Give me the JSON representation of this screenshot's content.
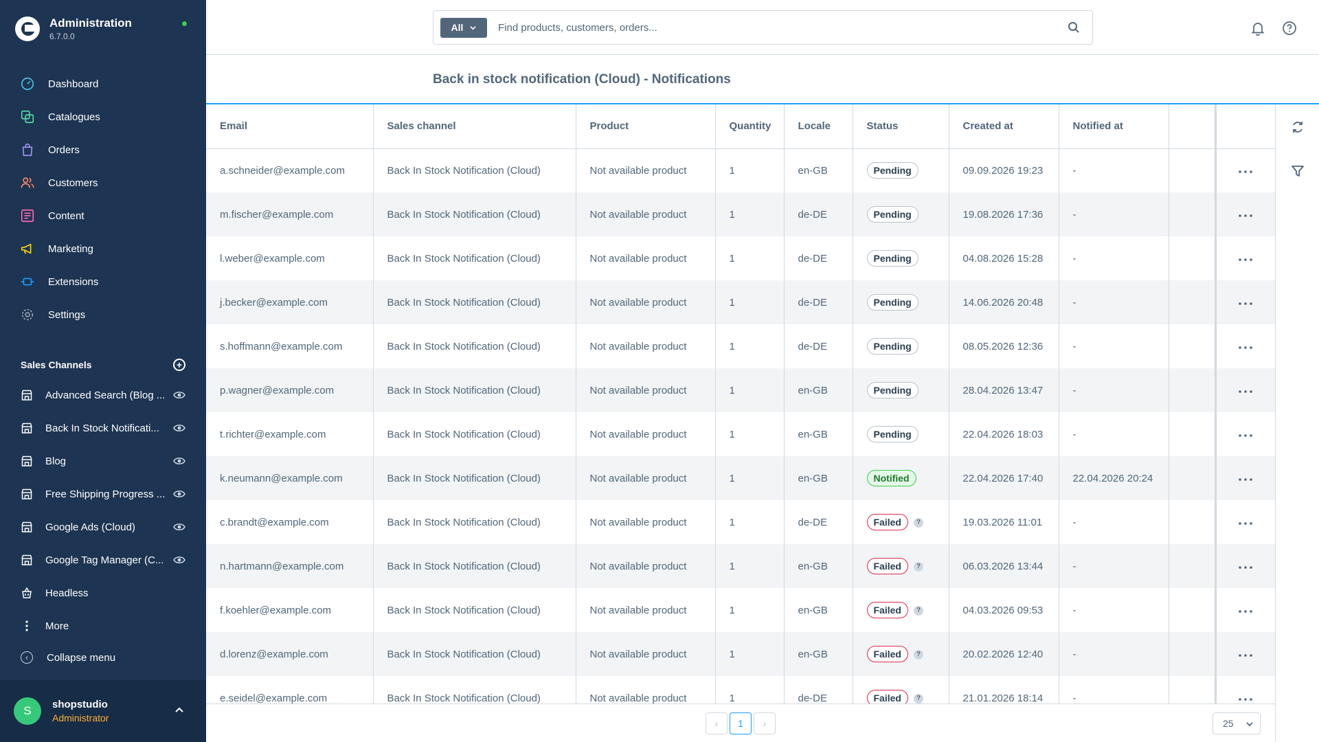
{
  "app": {
    "title": "Administration",
    "version": "6.7.0.0",
    "status_color": "#37d046"
  },
  "nav": {
    "items": [
      {
        "label": "Dashboard",
        "icon": "dashboard-icon",
        "color": "#4bc3e6"
      },
      {
        "label": "Catalogues",
        "icon": "catalogue-icon",
        "color": "#57d9a3"
      },
      {
        "label": "Orders",
        "icon": "orders-icon",
        "color": "#a092f0"
      },
      {
        "label": "Customers",
        "icon": "customers-icon",
        "color": "#f88962"
      },
      {
        "label": "Content",
        "icon": "content-icon",
        "color": "#ff68b4"
      },
      {
        "label": "Marketing",
        "icon": "marketing-icon",
        "color": "#ffd700"
      },
      {
        "label": "Extensions",
        "icon": "extensions-icon",
        "color": "#189eff"
      },
      {
        "label": "Settings",
        "icon": "settings-icon",
        "color": "#9aa8b5"
      }
    ]
  },
  "sales_channels": {
    "heading": "Sales Channels",
    "items": [
      {
        "label": "Advanced Search (Blog ..."
      },
      {
        "label": "Back In Stock Notificati..."
      },
      {
        "label": "Blog"
      },
      {
        "label": "Free Shipping Progress ..."
      },
      {
        "label": "Google Ads (Cloud)"
      },
      {
        "label": "Google Tag Manager (C..."
      },
      {
        "label": "Headless"
      },
      {
        "label": "More"
      }
    ]
  },
  "collapse_label": "Collapse menu",
  "user": {
    "initial": "S",
    "name": "shopstudio",
    "role": "Administrator"
  },
  "search": {
    "type_label": "All",
    "placeholder": "Find products, customers, orders..."
  },
  "page": {
    "title": "Back in stock notification (Cloud) - Notifications"
  },
  "table": {
    "columns": [
      "Email",
      "Sales channel",
      "Product",
      "Quantity",
      "Locale",
      "Status",
      "Created at",
      "Notified at"
    ],
    "rows": [
      {
        "email": "a.schneider@example.com",
        "channel": "Back In Stock Notification (Cloud)",
        "product": "Not available product",
        "qty": "1",
        "locale": "en-GB",
        "status": "Pending",
        "created": "09.09.2026 19:23",
        "notified": "-"
      },
      {
        "email": "m.fischer@example.com",
        "channel": "Back In Stock Notification (Cloud)",
        "product": "Not available product",
        "qty": "1",
        "locale": "de-DE",
        "status": "Pending",
        "created": "19.08.2026 17:36",
        "notified": "-"
      },
      {
        "email": "l.weber@example.com",
        "channel": "Back In Stock Notification (Cloud)",
        "product": "Not available product",
        "qty": "1",
        "locale": "de-DE",
        "status": "Pending",
        "created": "04.08.2026 15:28",
        "notified": "-"
      },
      {
        "email": "j.becker@example.com",
        "channel": "Back In Stock Notification (Cloud)",
        "product": "Not available product",
        "qty": "1",
        "locale": "de-DE",
        "status": "Pending",
        "created": "14.06.2026 20:48",
        "notified": "-"
      },
      {
        "email": "s.hoffmann@example.com",
        "channel": "Back In Stock Notification (Cloud)",
        "product": "Not available product",
        "qty": "1",
        "locale": "de-DE",
        "status": "Pending",
        "created": "08.05.2026 12:36",
        "notified": "-"
      },
      {
        "email": "p.wagner@example.com",
        "channel": "Back In Stock Notification (Cloud)",
        "product": "Not available product",
        "qty": "1",
        "locale": "en-GB",
        "status": "Pending",
        "created": "28.04.2026 13:47",
        "notified": "-"
      },
      {
        "email": "t.richter@example.com",
        "channel": "Back In Stock Notification (Cloud)",
        "product": "Not available product",
        "qty": "1",
        "locale": "en-GB",
        "status": "Pending",
        "created": "22.04.2026 18:03",
        "notified": "-"
      },
      {
        "email": "k.neumann@example.com",
        "channel": "Back In Stock Notification (Cloud)",
        "product": "Not available product",
        "qty": "1",
        "locale": "en-GB",
        "status": "Notified",
        "created": "22.04.2026 17:40",
        "notified": "22.04.2026 20:24"
      },
      {
        "email": "c.brandt@example.com",
        "channel": "Back In Stock Notification (Cloud)",
        "product": "Not available product",
        "qty": "1",
        "locale": "de-DE",
        "status": "Failed",
        "created": "19.03.2026 11:01",
        "notified": "-"
      },
      {
        "email": "n.hartmann@example.com",
        "channel": "Back In Stock Notification (Cloud)",
        "product": "Not available product",
        "qty": "1",
        "locale": "en-GB",
        "status": "Failed",
        "created": "06.03.2026 13:44",
        "notified": "-"
      },
      {
        "email": "f.koehler@example.com",
        "channel": "Back In Stock Notification (Cloud)",
        "product": "Not available product",
        "qty": "1",
        "locale": "en-GB",
        "status": "Failed",
        "created": "04.03.2026 09:53",
        "notified": "-"
      },
      {
        "email": "d.lorenz@example.com",
        "channel": "Back In Stock Notification (Cloud)",
        "product": "Not available product",
        "qty": "1",
        "locale": "en-GB",
        "status": "Failed",
        "created": "20.02.2026 12:40",
        "notified": "-"
      },
      {
        "email": "e.seidel@example.com",
        "channel": "Back In Stock Notification (Cloud)",
        "product": "Not available product",
        "qty": "1",
        "locale": "de-DE",
        "status": "Failed",
        "created": "21.01.2026 18:14",
        "notified": "-"
      }
    ],
    "help_glyph": "?"
  },
  "pagination": {
    "prev": "‹",
    "current": "1",
    "next": "›",
    "per_page": "25"
  }
}
